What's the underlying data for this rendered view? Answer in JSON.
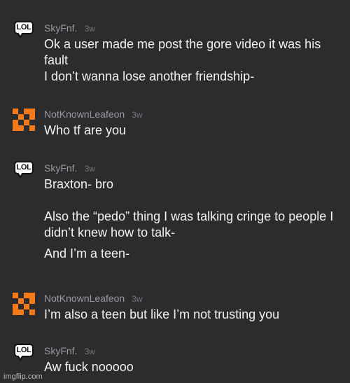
{
  "comments": [
    {
      "username": "SkyFnf.",
      "timestamp": "3w",
      "avatar_text": "LOL",
      "paragraphs": [
        "Ok a user made me post the gore video it was his fault",
        "I don’t wanna lose another friendship-"
      ]
    },
    {
      "username": "NotKnownLeafeon",
      "timestamp": "3w",
      "paragraphs": [
        "Who tf are you"
      ]
    },
    {
      "username": "SkyFnf.",
      "timestamp": "3w",
      "avatar_text": "LOL",
      "paragraphs": [
        "Braxton- bro",
        "Also the “pedo” thing I was talking cringe to people I didn’t knew how to talk-",
        "And I’m a teen-"
      ]
    },
    {
      "username": "NotKnownLeafeon",
      "timestamp": "3w",
      "paragraphs": [
        "I’m also a teen but like I’m not trusting you"
      ]
    },
    {
      "username": "SkyFnf.",
      "timestamp": "3w",
      "avatar_text": "LOL",
      "paragraphs": [
        "Aw fuck nooooo"
      ]
    }
  ],
  "watermark": "imgflip.com",
  "colors": {
    "background": "#2c2c2e",
    "avatar_orange": "#f47a1a",
    "text": "#f2f2f2",
    "username": "#9a9a9f"
  }
}
